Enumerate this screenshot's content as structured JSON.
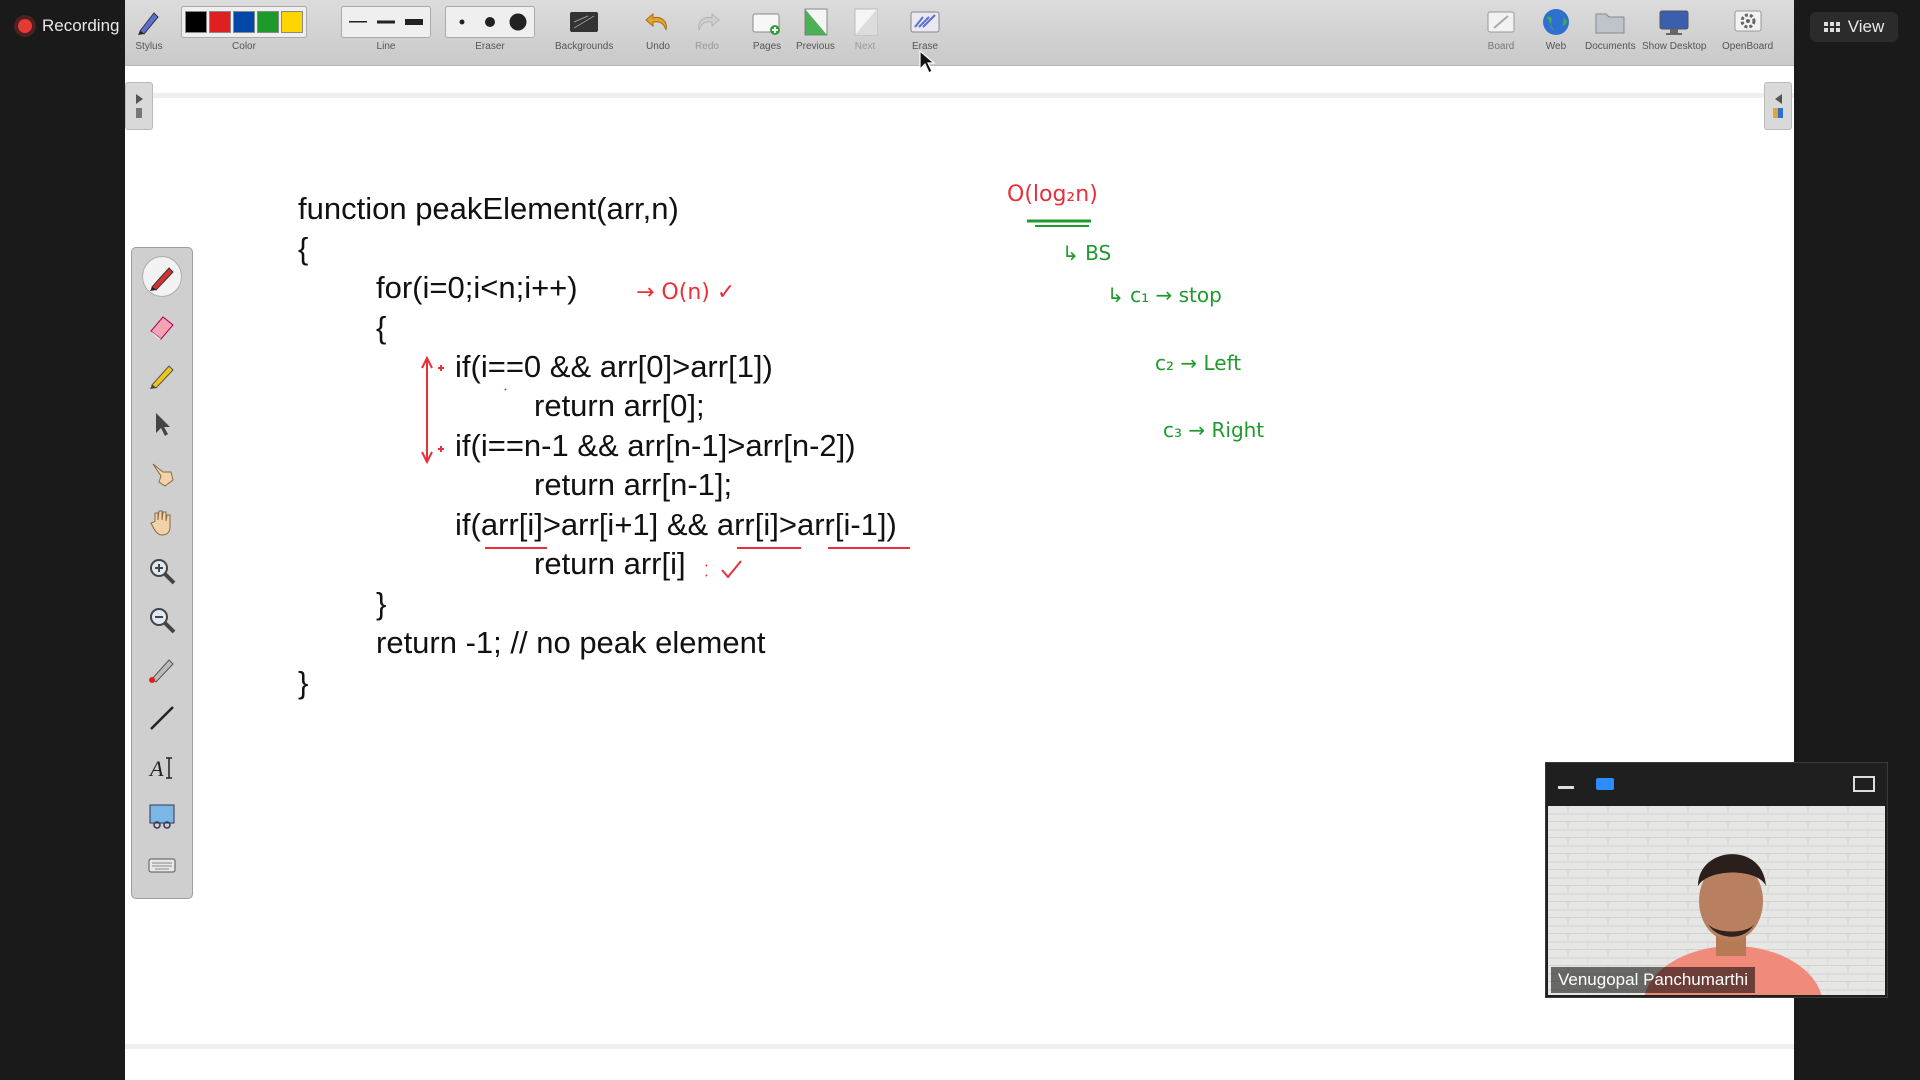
{
  "recording": {
    "label": "Recording"
  },
  "view_button": {
    "label": "View"
  },
  "toolbar": {
    "stylus": "Stylus",
    "color": "Color",
    "line": "Line",
    "eraser": "Eraser",
    "backgrounds": "Backgrounds",
    "undo": "Undo",
    "redo": "Redo",
    "pages": "Pages",
    "previous": "Previous",
    "next": "Next",
    "erase": "Erase",
    "board": "Board",
    "web": "Web",
    "documents": "Documents",
    "show_desktop": "Show Desktop",
    "openboard": "OpenBoard",
    "colors": [
      "#000000",
      "#e02020",
      "#0047a8",
      "#1e9a2a",
      "#ffd500"
    ]
  },
  "board": {
    "code_lines": [
      "function peakElement(arr,n)",
      "{",
      "for(i=0;i<n;i++)",
      "{",
      "if(i==0 && arr[0]>arr[1])",
      "return arr[0];",
      "if(i==n-1 && arr[n-1]>arr[n-2])",
      "return arr[n-1];",
      "if(arr[i]>arr[i+1] && arr[i]>arr[i-1])",
      "return arr[i]",
      "}",
      "return -1; // no peak element",
      "}"
    ],
    "annotations": {
      "loop_complexity": "→ O(n) ✓",
      "complexity": "O(log₂n)",
      "bs": "↳ BS",
      "c1": "↳ c₁  → stop",
      "c2": "c₂ → Left",
      "c3": "c₃ → Right"
    },
    "ink_colors": {
      "red": "#e8303a",
      "green": "#1f9a2c"
    }
  },
  "participant": {
    "name": "Venugopal Panchumarthi"
  }
}
